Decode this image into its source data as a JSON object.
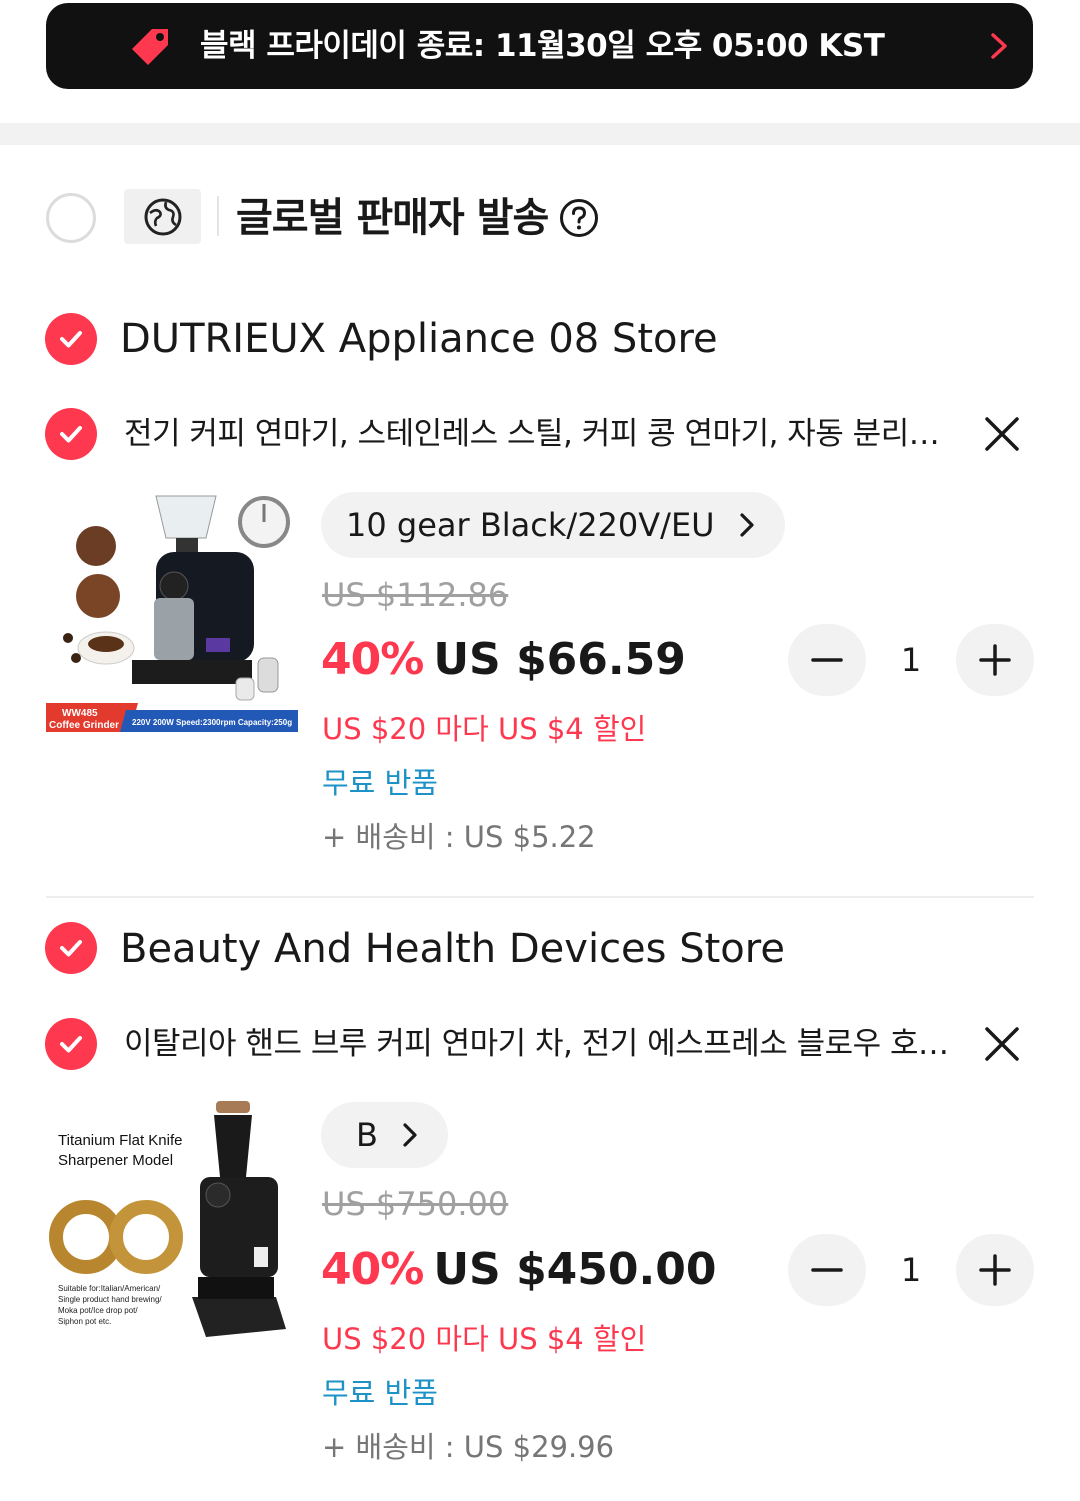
{
  "banner": {
    "text": "블랙 프라이데이 종료: 11월30일 오후 05:00 KST",
    "icon": "price-tag-icon"
  },
  "section": {
    "title": "글로벌 판매자 발송",
    "icon": "globe-icon"
  },
  "stores": [
    {
      "name": "DUTRIEUX Appliance 08 Store",
      "item": {
        "title": "전기 커피 연마기, 스테인레스 스틸, 커피 콩 연마기, 자동 분리기, 가정용 커피 그라인더",
        "variant": "10 gear Black/220V/EU",
        "original_price": "US $112.86",
        "discount": "40%",
        "price": "US $66.59",
        "promo": "US $20 마다 US $4 할인",
        "free_return": "무료 반품",
        "shipping": "+ 배송비 : US $5.22",
        "quantity": "1",
        "image_text": {
          "badge_model": "WW485",
          "badge_name": "Coffee Grinder",
          "badge_specs": "220V 200W Speed:2300rpm Capacity:250g"
        }
      }
    },
    {
      "name": "Beauty And Health Devices Store",
      "item": {
        "title": "이탈리아 핸드 브루 커피 연마기 차, 전기 에스프레소 블로우 호퍼 그라인더",
        "variant": "B",
        "original_price": "US $750.00",
        "discount": "40%",
        "price": "US $450.00",
        "promo": "US $20 마다 US $4 할인",
        "free_return": "무료 반품",
        "shipping": "+ 배송비 : US $29.96",
        "quantity": "1",
        "image_text": {
          "heading": "Titanium Flat Knife Sharpener Model",
          "note": "Suitable for:Italian/American/ Single product hand brewing/ Moka pot/Ice drop pot/ Siphon pot etc."
        }
      }
    }
  ],
  "colors": {
    "accent": "#fd384f",
    "link": "#1d92c6",
    "banner_bg": "#111111"
  }
}
